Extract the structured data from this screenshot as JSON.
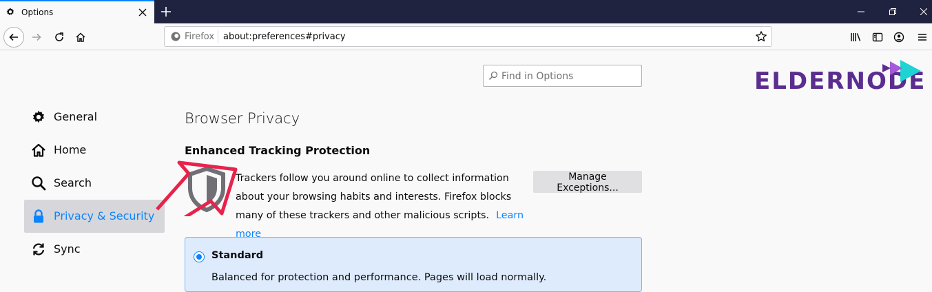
{
  "browser": {
    "tab_title": "Options",
    "url_site_label": "Firefox",
    "url": "about:preferences#privacy"
  },
  "search": {
    "placeholder": "Find in Options"
  },
  "logo": {
    "text": "eldernode",
    "brand_color": "#5b2d8f",
    "accent_color": "#1fd3d3"
  },
  "sidebar": {
    "items": [
      {
        "label": "General",
        "icon": "gear-icon"
      },
      {
        "label": "Home",
        "icon": "home-icon"
      },
      {
        "label": "Search",
        "icon": "search-icon"
      },
      {
        "label": "Privacy & Security",
        "icon": "lock-icon",
        "selected": true
      },
      {
        "label": "Sync",
        "icon": "sync-icon"
      }
    ]
  },
  "main": {
    "section_title": "Browser Privacy",
    "etp_title": "Enhanced Tracking Protection",
    "etp_description": "Trackers follow you around online to collect information about your browsing habits and interests. Firefox blocks many of these trackers and other malicious scripts.",
    "learn_more": "Learn more",
    "manage_exceptions": "Manage Exceptions...",
    "standard": {
      "title": "Standard",
      "description": "Balanced for protection and performance. Pages will load normally.",
      "checked": true
    }
  },
  "colors": {
    "accent": "#0a84ff",
    "tabstrip": "#202340",
    "annotation_arrow": "#e8234a"
  }
}
